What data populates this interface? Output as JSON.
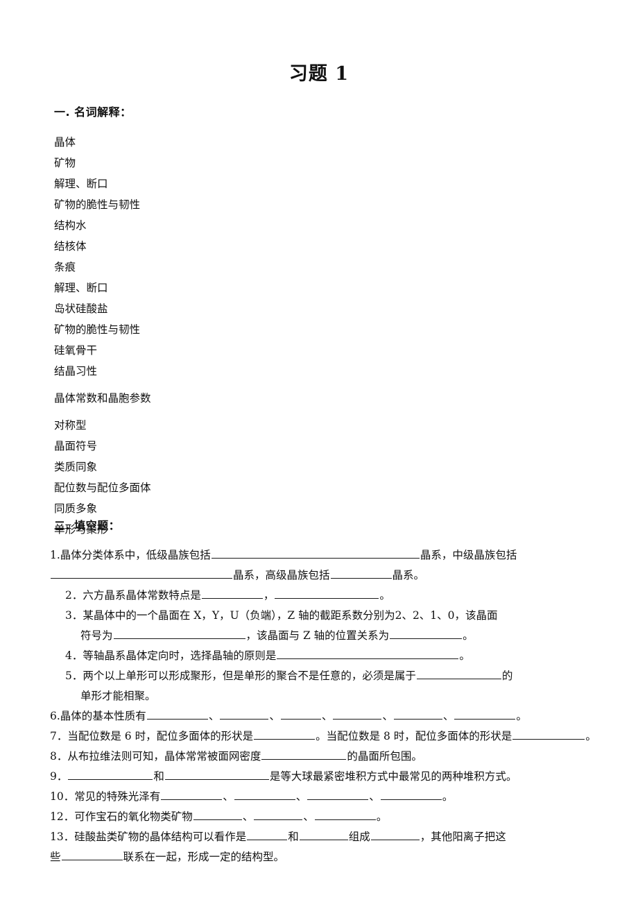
{
  "document": {
    "title": "习题 1"
  },
  "sections": [
    {
      "id": "section-1",
      "heading": "一. 名词解释：",
      "terms": [
        "晶体",
        "矿物",
        "解理、断口",
        "矿物的脆性与韧性",
        "结构水",
        "结核体",
        "条痕",
        "解理、断口",
        "岛状硅酸盐",
        "矿物的脆性与韧性",
        "硅氧骨干",
        "结晶习性",
        "晶体常数和晶胞参数",
        "对称型",
        "晶面符号",
        "类质同象",
        "配位数与配位多面体",
        "同质多象",
        "单形与聚形"
      ]
    },
    {
      "id": "section-2",
      "heading": "二. 填空题：",
      "questions": {
        "q1": {
          "num": "1.",
          "p1": "晶体分类体系中，低级晶族包括",
          "p2": "晶系，中级晶族包括",
          "p3": "晶系，高级晶族包括",
          "p4": "晶系。"
        },
        "q2": {
          "num": "2．",
          "p1": "六方晶系晶体常数特点是",
          "p2": "，",
          "p3": "。"
        },
        "q3": {
          "num": "3．",
          "p1": "某晶体中的一个晶面在 X，Y，U（负端），Z 轴的截距系数分别为2、2、1、0，该晶面",
          "p2": "符号为",
          "p3": "，该晶面与 Z 轴的位置关系为",
          "p4": "。"
        },
        "q4": {
          "num": "4．",
          "p1": "等轴晶系晶体定向时，选择晶轴的原则是",
          "p2": "。"
        },
        "q5": {
          "num": "5．",
          "p1": "两个以上单形可以形成聚形，但是单形的聚合不是任意的，必须是属于",
          "p2": "的",
          "p3": "单形才能相聚。"
        },
        "q6": {
          "num": "6.",
          "p1": "晶体的基本性质有",
          "sep1": "、",
          "sep2": "、",
          "sep3": "、",
          "sep4": "、",
          "sep5": "、",
          "p2": "。"
        },
        "q7": {
          "num": "7．",
          "p1": "当配位数是 6 时，配位多面体的形状是",
          "p2": "。当配位数是 8 时，配位多面体的形状是",
          "p3": "。"
        },
        "q8": {
          "num": "8．",
          "p1": "从布拉维法则可知，晶体常常被面网密度",
          "p2": "的晶面所包围。"
        },
        "q9": {
          "num": "9．",
          "p1": "和",
          "p2": "是等大球最紧密堆积方式中最常见的两种堆积方式。"
        },
        "q10": {
          "num": "10．",
          "p1": "常见的特殊光泽有",
          "sep1": "、",
          "sep2": "、",
          "sep3": "、",
          "p2": "。"
        },
        "q12": {
          "num": "12．",
          "p1": "可作宝石的氧化物类矿物",
          "sep1": "、",
          "sep2": "、",
          "p2": "。"
        },
        "q13": {
          "num": "13．",
          "p1": "硅酸盐类矿物的晶体结构可以看作是",
          "p2": "和",
          "p3": "组成",
          "p4": "，其他阳离子把这",
          "p5": "些",
          "p6": "联系在一起，形成一定的结构型。"
        }
      }
    }
  ]
}
